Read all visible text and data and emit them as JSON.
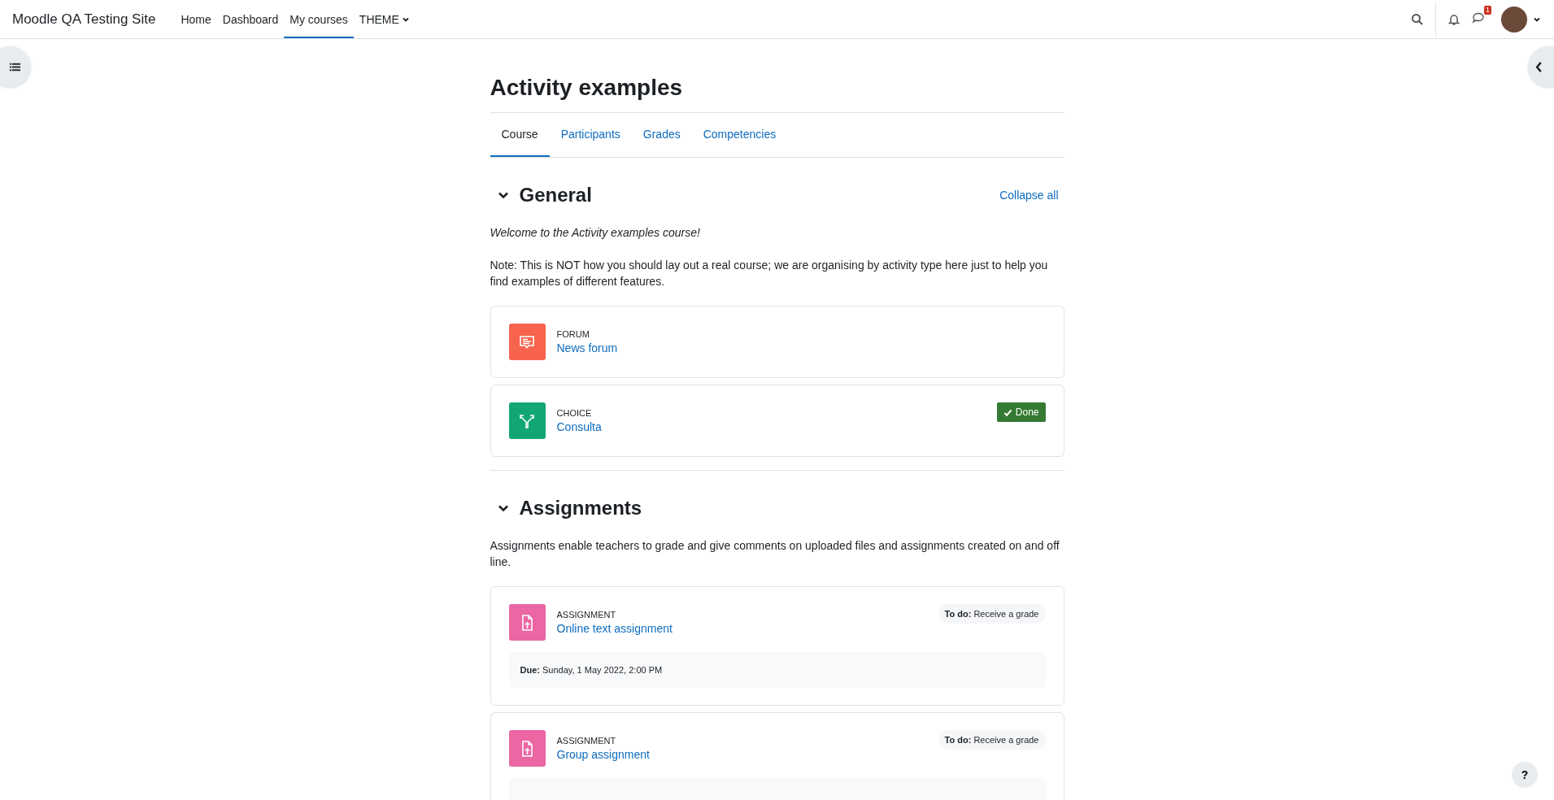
{
  "navbar": {
    "site_name": "Moodle QA Testing Site",
    "items": [
      {
        "label": "Home",
        "selected": false,
        "dropdown": false
      },
      {
        "label": "Dashboard",
        "selected": false,
        "dropdown": false
      },
      {
        "label": "My courses",
        "selected": true,
        "dropdown": false
      },
      {
        "label": "THEME",
        "selected": false,
        "dropdown": true
      }
    ],
    "message_count": "1"
  },
  "course": {
    "title": "Activity examples",
    "tabs": [
      {
        "label": "Course",
        "selected": true
      },
      {
        "label": "Participants",
        "selected": false
      },
      {
        "label": "Grades",
        "selected": false
      },
      {
        "label": "Competencies",
        "selected": false
      }
    ],
    "collapse_all": "Collapse all",
    "sections": [
      {
        "title": "General",
        "expanded": true,
        "summary": [
          "*Welcome to the Activity examples course!*",
          "Note: This is NOT how you should lay out a real course; we are organising by activity type here just to help you find examples of different features."
        ],
        "activities": [
          {
            "kind": "forum",
            "type_label": "FORUM",
            "name": "News forum"
          },
          {
            "kind": "choice",
            "type_label": "CHOICE",
            "name": "Consulta",
            "completion": {
              "kind": "done",
              "label": "Done"
            }
          }
        ]
      },
      {
        "title": "Assignments",
        "expanded": true,
        "summary": [
          "Assignments enable teachers to grade and give comments on uploaded files and assignments created on and off line."
        ],
        "activities": [
          {
            "kind": "assign",
            "type_label": "ASSIGNMENT",
            "name": "Online text assignment",
            "completion": {
              "kind": "todo",
              "label": "**To do:** Receive a grade"
            },
            "dates": "**Due:** Sunday, 1 May 2022, 2:00 PM"
          },
          {
            "kind": "assign",
            "type_label": "ASSIGNMENT",
            "name": "Group assignment",
            "completion": {
              "kind": "todo",
              "label": "**To do:** Receive a grade"
            },
            "dates_box": true
          }
        ]
      }
    ]
  },
  "help_button": "?"
}
